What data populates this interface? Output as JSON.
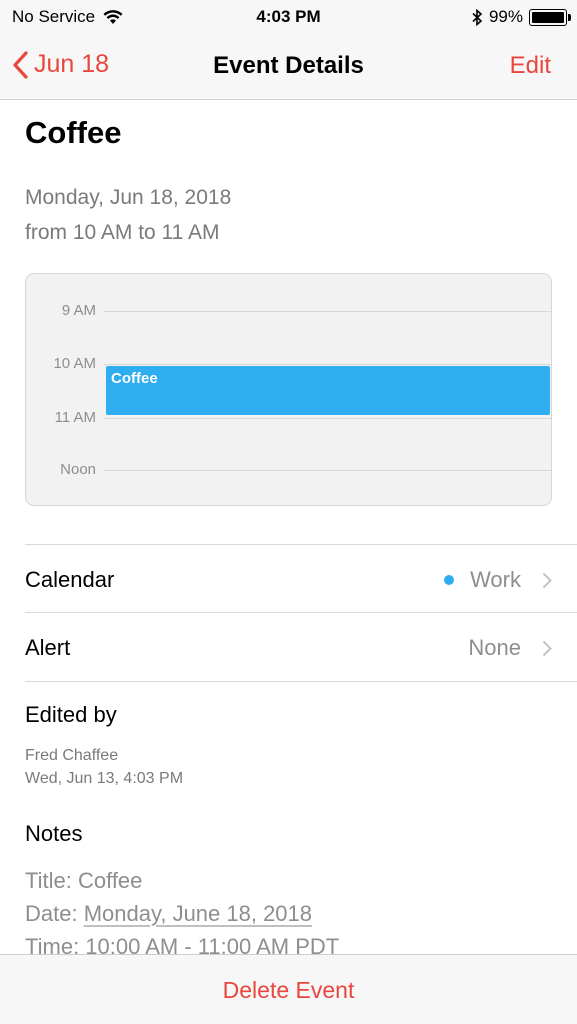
{
  "status_bar": {
    "carrier": "No Service",
    "time": "4:03 PM",
    "battery": "99%",
    "battery_level": 0.99,
    "icons": [
      "wifi-icon",
      "bluetooth-icon",
      "battery-icon"
    ]
  },
  "nav": {
    "back_label": "Jun 18",
    "title": "Event Details",
    "edit_label": "Edit"
  },
  "event": {
    "title": "Coffee",
    "date_line": "Monday, Jun 18, 2018",
    "time_line": "from 10 AM to 11 AM"
  },
  "day_view": {
    "hours": [
      "9 AM",
      "10 AM",
      "11 AM",
      "Noon"
    ],
    "event_label": "Coffee",
    "event_color": "#2eadf1"
  },
  "calendar_row": {
    "label": "Calendar",
    "value": "Work"
  },
  "alert_row": {
    "label": "Alert",
    "value": "None"
  },
  "edited_by": {
    "label": "Edited by",
    "name": "Fred Chaffee",
    "timestamp": "Wed, Jun 13, 4:03 PM"
  },
  "notes": {
    "label": "Notes",
    "title_prefix": "Title: ",
    "title_value": "Coffee",
    "date_prefix": "Date: ",
    "date_value": "Monday, June 18, 2018",
    "time_prefix": "Time: ",
    "time_value": "10:00 AM - 11:00 AM PDT"
  },
  "bottom": {
    "delete_label": "Delete Event"
  },
  "colors": {
    "accent": "#e8473e",
    "calendar_blue": "#2eadf1"
  }
}
